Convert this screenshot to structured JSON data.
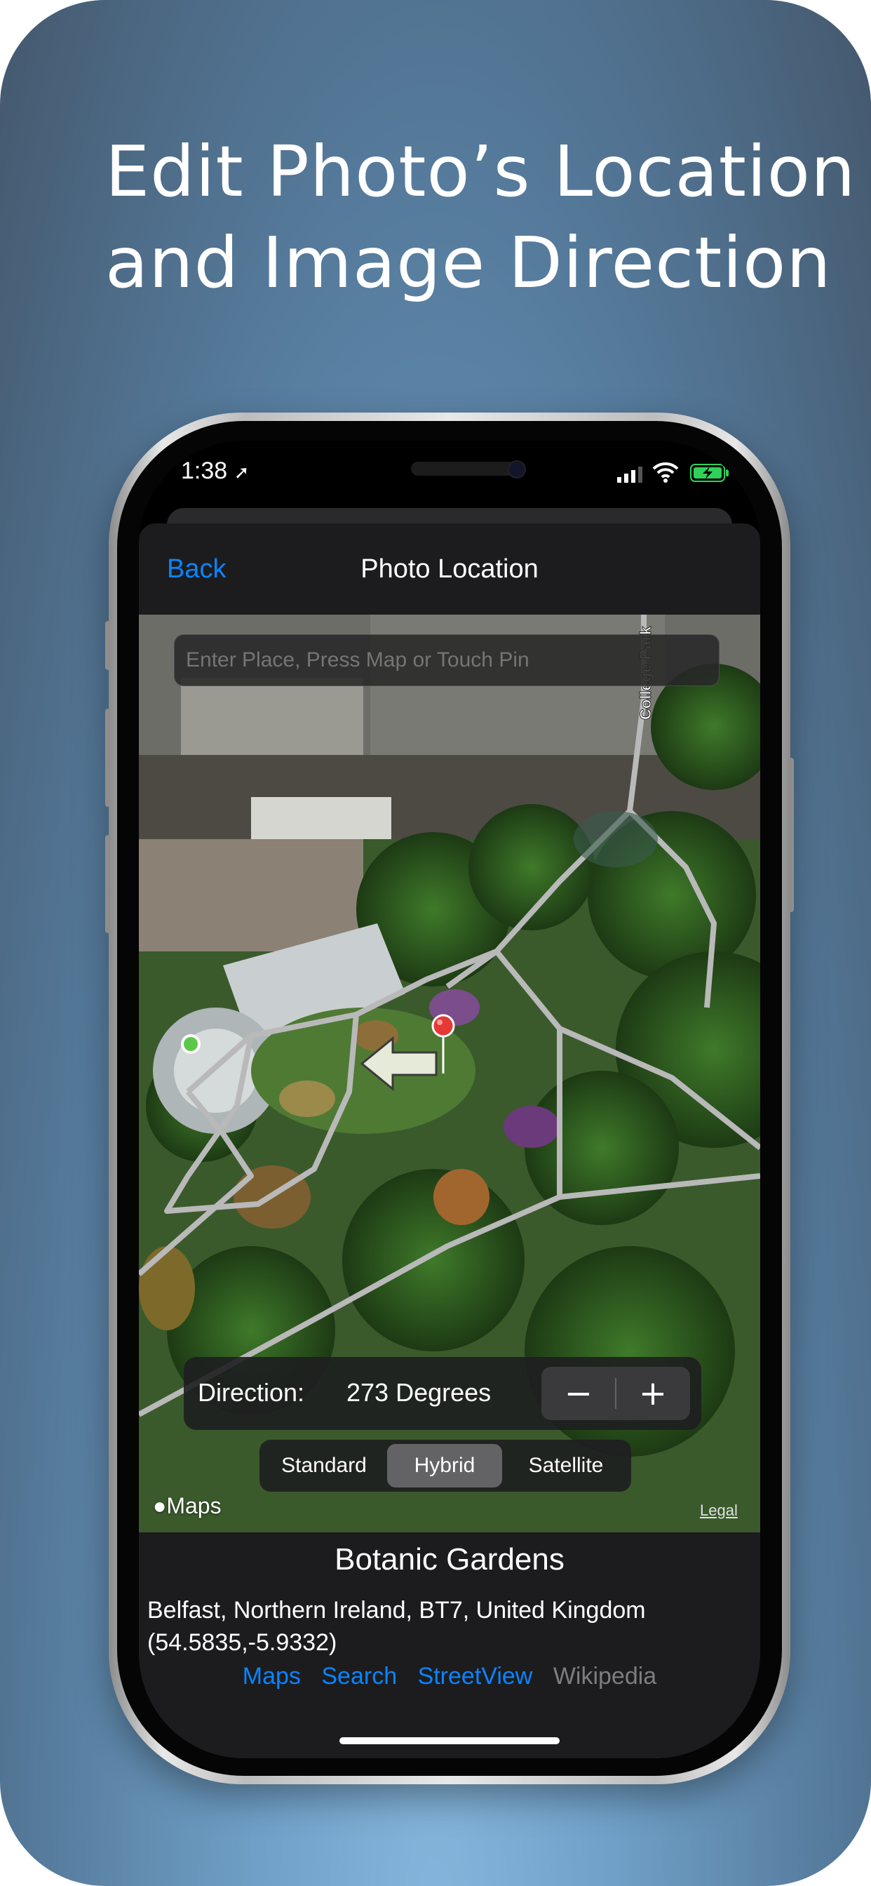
{
  "headline": {
    "line1": "Edit Photo’s Location",
    "line2": "and Image Direction"
  },
  "status_bar": {
    "time": "1:38"
  },
  "nav": {
    "back_label": "Back",
    "title": "Photo Location"
  },
  "map": {
    "search_placeholder": "Enter Place, Press Map or Touch Pin",
    "road_label": "College Park",
    "direction_label": "Direction:",
    "direction_value": "273 Degrees",
    "minus_label": "−",
    "plus_label": "+",
    "map_types": [
      "Standard",
      "Hybrid",
      "Satellite"
    ],
    "selected_map_type": "Hybrid",
    "maps_logo": "Maps",
    "legal": "Legal"
  },
  "info": {
    "place_name": "Botanic Gardens",
    "address": "Belfast, Northern Ireland, BT7, United Kingdom",
    "coordinates": "(54.5835,-5.9332)",
    "links": {
      "maps": "Maps",
      "search": "Search",
      "streetview": "StreetView",
      "wikipedia": "Wikipedia"
    }
  },
  "colors": {
    "accent": "#0a84ff",
    "pin": "#e53935",
    "user_dot": "#5cc84a"
  }
}
